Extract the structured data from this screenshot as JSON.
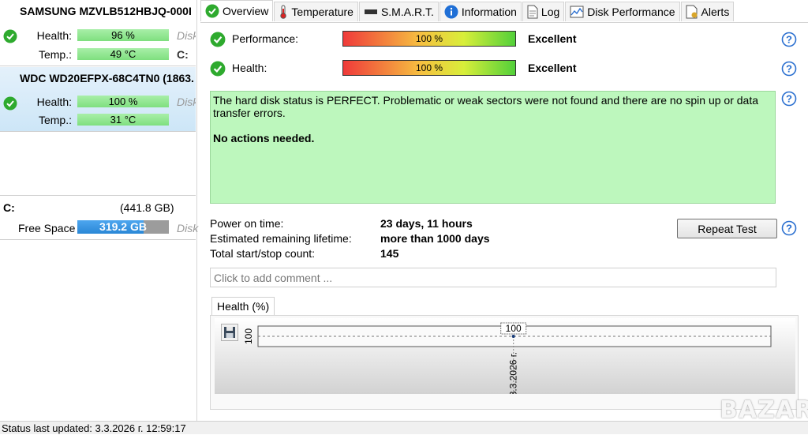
{
  "disks": [
    {
      "name": "SAMSUNG MZVLB512HBJQ-000I",
      "health_label": "Health:",
      "health_value": "96 %",
      "health_side": "Disk",
      "temp_label": "Temp.:",
      "temp_value": "49 °C",
      "temp_side": "C:"
    },
    {
      "name": "WDC WD20EFPX-68C4TN0 (1863.",
      "health_label": "Health:",
      "health_value": "100 %",
      "health_side": "Disk",
      "temp_label": "Temp.:",
      "temp_value": "31 °C"
    }
  ],
  "volume": {
    "letter": "C:",
    "size": "(441.8 GB)",
    "free_label": "Free Space",
    "free_value": "319.2 GB",
    "free_fraction": 0.72,
    "side": "Disk"
  },
  "status_bar": {
    "text": "Status last updated: 3.3.2026 г. 12:59:17"
  },
  "tabs": [
    {
      "label": "Overview",
      "icon": "check-circle-icon",
      "active": true
    },
    {
      "label": "Temperature",
      "icon": "thermometer-icon"
    },
    {
      "label": "S.M.A.R.T.",
      "icon": "smart-bar-icon"
    },
    {
      "label": "Information",
      "icon": "info-icon"
    },
    {
      "label": "Log",
      "icon": "document-icon"
    },
    {
      "label": "Disk Performance",
      "icon": "chart-icon"
    },
    {
      "label": "Alerts",
      "icon": "alerts-icon"
    }
  ],
  "overview": {
    "performance": {
      "label": "Performance:",
      "value": "100 %",
      "verdict": "Excellent"
    },
    "health": {
      "label": "Health:",
      "value": "100 %",
      "verdict": "Excellent"
    },
    "status_message": "The hard disk status is PERFECT. Problematic or weak sectors were not found and there are no spin up or data transfer errors.",
    "action_message": "No actions needed.",
    "power_on_label": "Power on time:",
    "power_on_value": "23 days, 11 hours",
    "lifetime_label": "Estimated remaining lifetime:",
    "lifetime_value": "more than 1000 days",
    "startstop_label": "Total start/stop count:",
    "startstop_value": "145",
    "repeat_button": "Repeat Test",
    "comment_placeholder": "Click to add comment ..."
  },
  "colors": {
    "ok_green": "#2eaa2e",
    "help_blue": "#2a6fd0",
    "status_green": "#bdf7bd"
  },
  "chart_data": {
    "type": "line",
    "tab_label": "Health (%)",
    "x": [
      "3.3.2026 г."
    ],
    "series": [
      {
        "values": [
          100
        ]
      }
    ],
    "point_labels": [
      "100"
    ],
    "yticks": [
      "100"
    ],
    "ylim": [
      99,
      101
    ],
    "grid": false
  }
}
